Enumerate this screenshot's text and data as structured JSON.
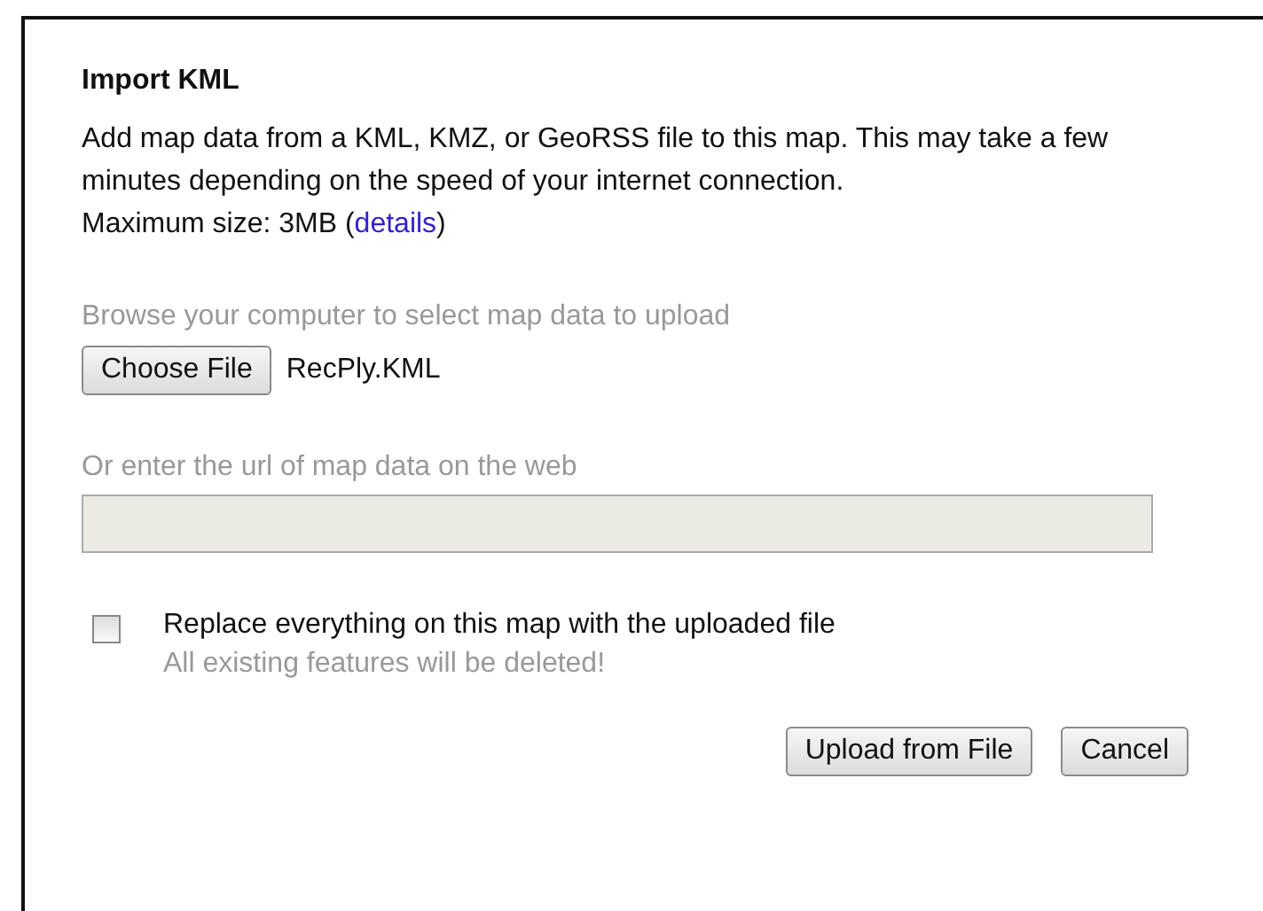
{
  "dialog": {
    "title": "Import KML",
    "description": "Add map data from a KML, KMZ, or GeoRSS file to this map. This may take a few minutes depending on the speed of your internet connection.",
    "max_size": "Maximum size: 3MB (",
    "details_link": "details",
    "max_size_end": ")",
    "browse_label": "Browse your computer to select map data to upload",
    "choose_button": "Choose File",
    "file_name": "RecPly.KML",
    "url_label": "Or enter the url of map data on the web",
    "url_field": {
      "disabled": true
    },
    "replace": {
      "label": "Replace everything on this map with the uploaded file",
      "hint": "All existing features will be deleted!",
      "checked": false
    },
    "buttons": [
      "Upload from File",
      "Cancel"
    ]
  }
}
